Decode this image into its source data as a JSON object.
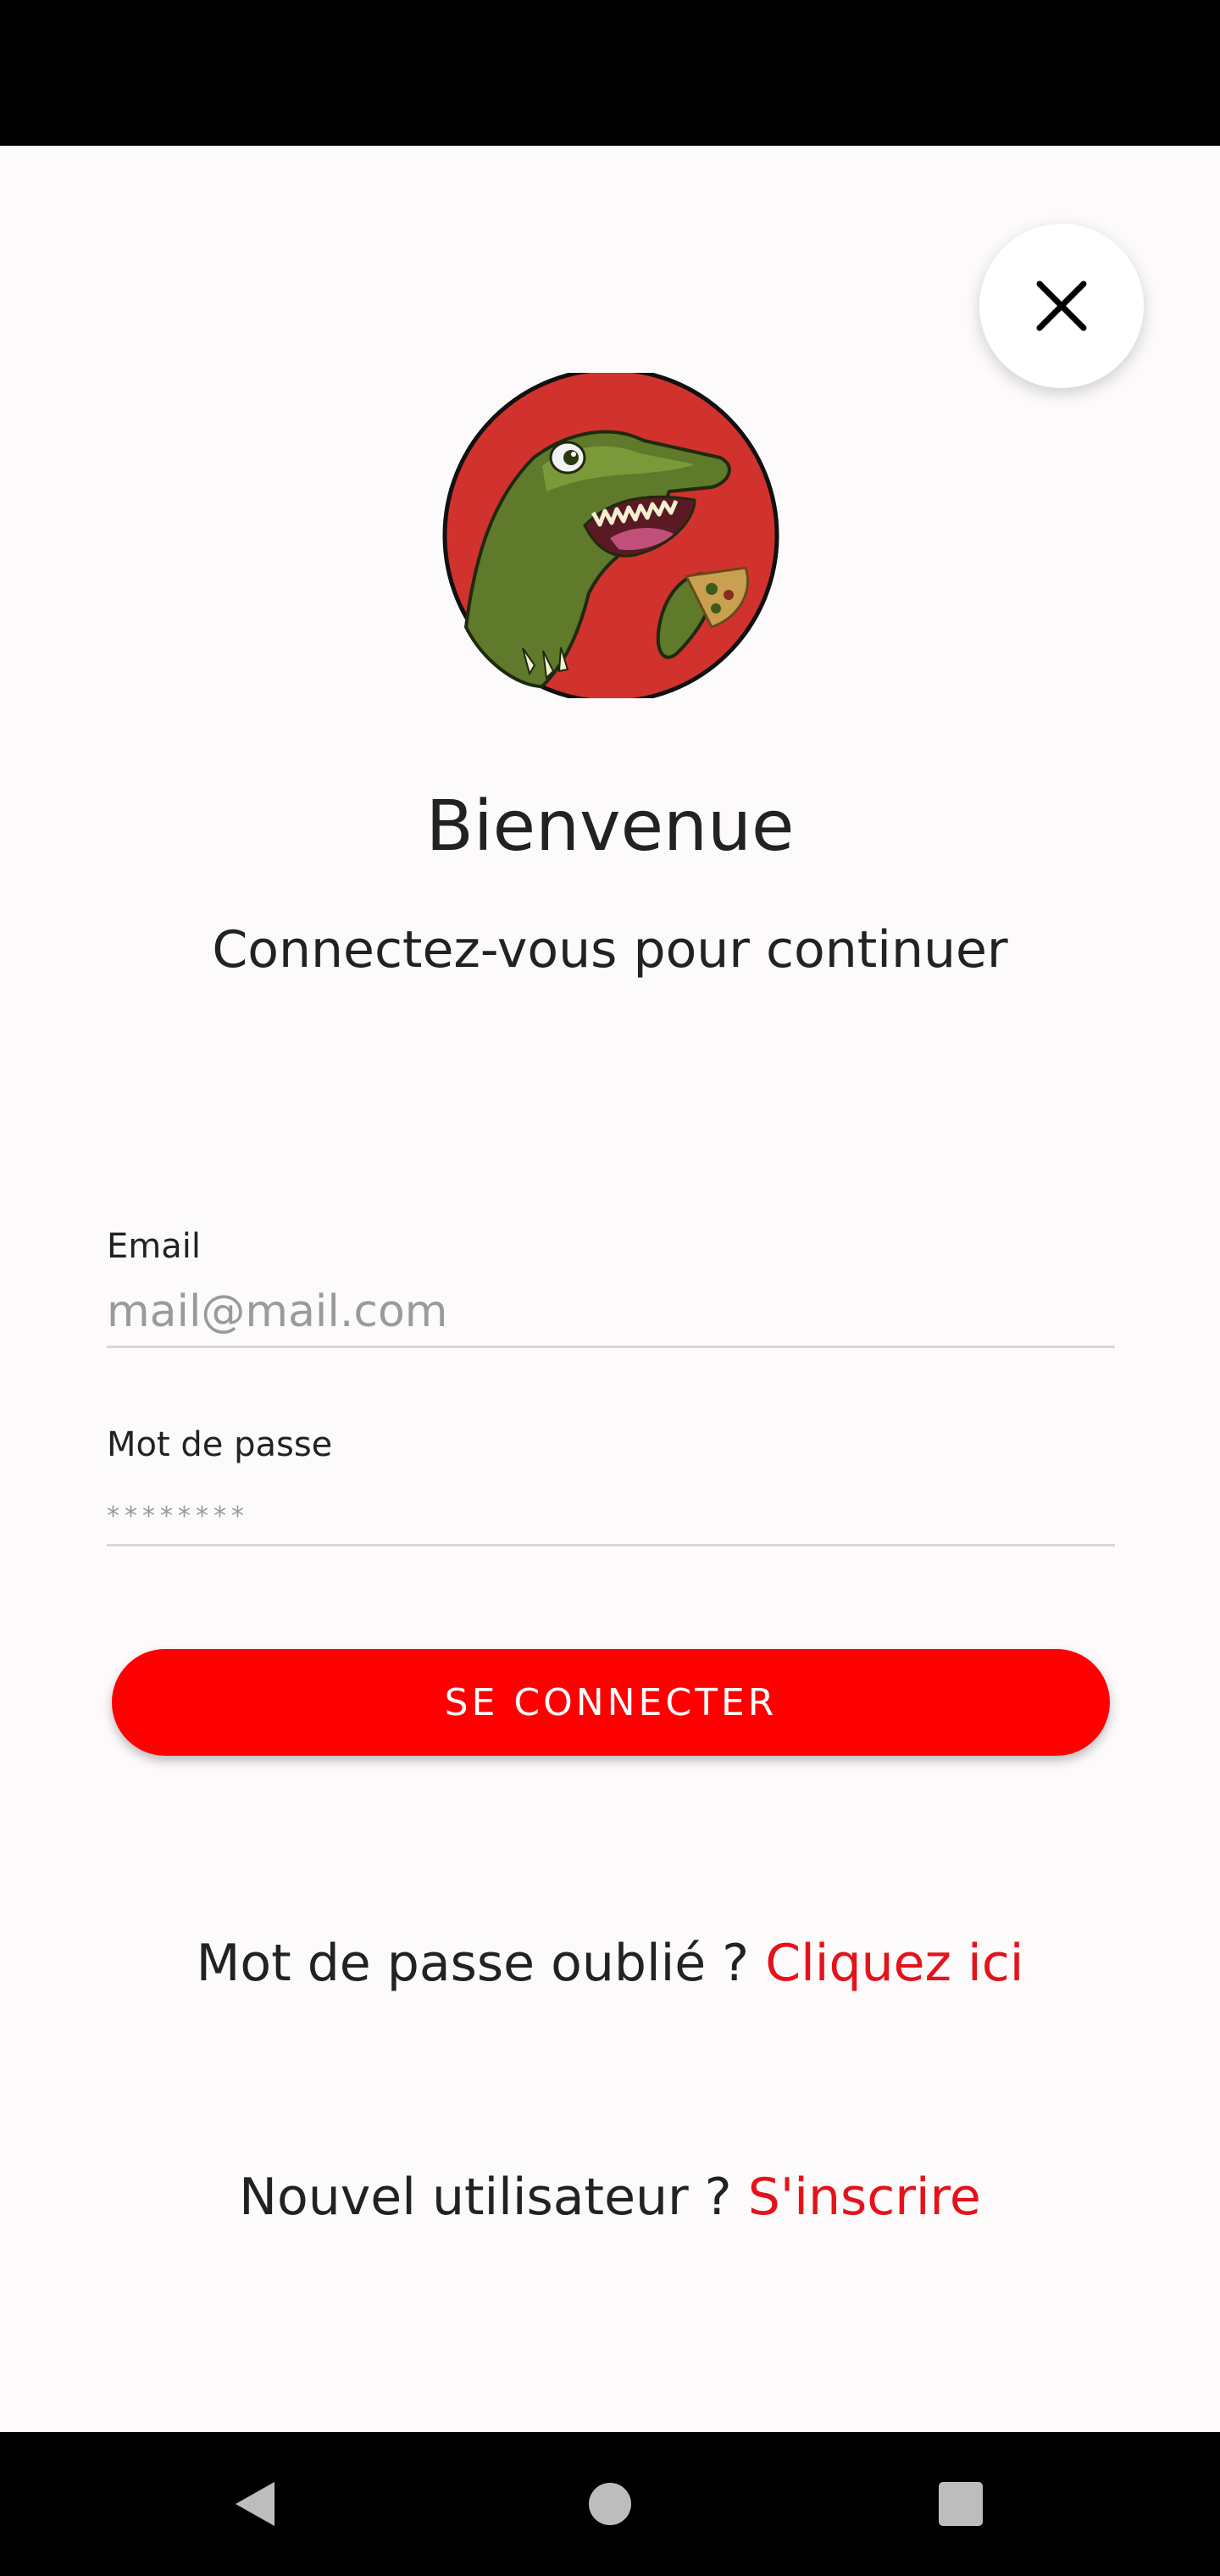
{
  "header": {
    "title": "Bienvenue",
    "subtitle": "Connectez-vous pour continuer"
  },
  "form": {
    "email_label": "Email",
    "email_placeholder": "mail@mail.com",
    "email_value": "",
    "password_label": "Mot de passe",
    "password_placeholder": "********",
    "password_value": "",
    "submit_label": "SE CONNECTER"
  },
  "links": {
    "forgot_text": "Mot de passe oublié ?",
    "forgot_link": "Cliquez ici",
    "signup_text": "Nouvel utilisateur ?",
    "signup_link": "S'inscrire"
  },
  "icons": {
    "close": "close-icon",
    "logo": "dinosaur-pizza-logo",
    "nav_back": "back-triangle-icon",
    "nav_home": "home-circle-icon",
    "nav_recents": "recents-square-icon"
  },
  "colors": {
    "accent": "#fe0000",
    "link": "#e4131a",
    "logo_background": "#d2322d",
    "background": "#fcfafb"
  }
}
